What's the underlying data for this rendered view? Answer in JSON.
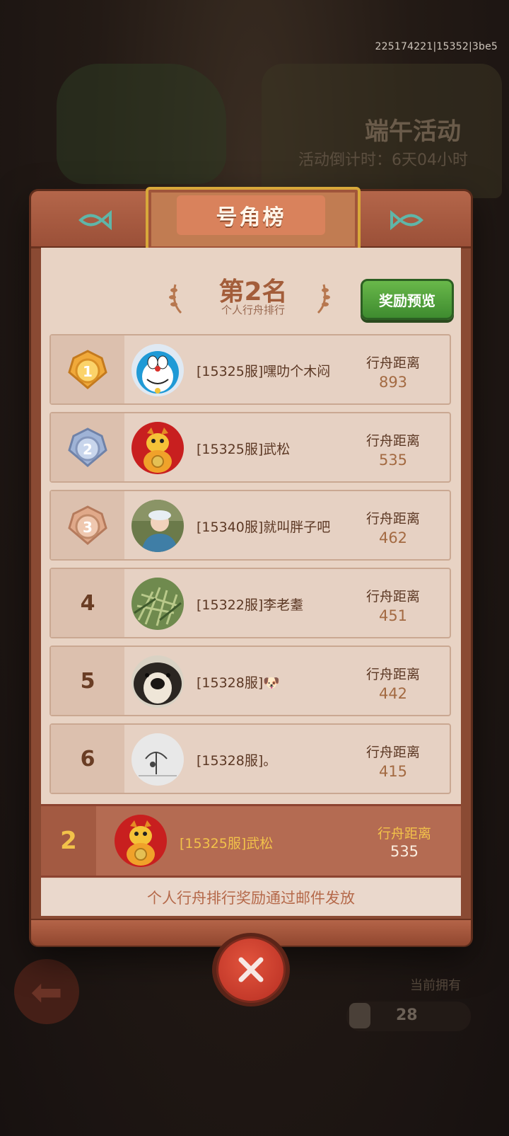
{
  "session_id": "225174221|15352|3be5",
  "background": {
    "event_title": "端午活动",
    "countdown": "活动倒计时：6天04小时",
    "owned_label": "当前拥有",
    "owned_count": "28"
  },
  "panel": {
    "title": "号角榜",
    "my_rank_title": "第2名",
    "my_rank_subtitle": "个人行舟排行",
    "reward_button": "奖励预览",
    "mail_note": "个人行舟排行奖励通过邮件发放"
  },
  "rankings": [
    {
      "rank": "1",
      "name": "[15325服]嘿叻个木闷",
      "dist_label": "行舟距离",
      "distance": "893",
      "avatar": "doraemon-avatar",
      "medal": "gold"
    },
    {
      "rank": "2",
      "name": "[15325服]武松",
      "dist_label": "行舟距离",
      "distance": "535",
      "avatar": "dragon-avatar",
      "medal": "silver"
    },
    {
      "rank": "3",
      "name": "[15340服]就叫胖子吧",
      "dist_label": "行舟距离",
      "distance": "462",
      "avatar": "child-photo-avatar",
      "medal": "bronze"
    },
    {
      "rank": "4",
      "name": "[15322服]李老耋",
      "dist_label": "行舟距离",
      "distance": "451",
      "avatar": "plant-avatar",
      "medal": ""
    },
    {
      "rank": "5",
      "name": "[15328服]🐶",
      "dist_label": "行舟距离",
      "distance": "442",
      "avatar": "dog-avatar",
      "medal": ""
    },
    {
      "rank": "6",
      "name": "[15328服]。",
      "dist_label": "行舟距离",
      "distance": "415",
      "avatar": "sketch-avatar",
      "medal": ""
    }
  ],
  "my_entry": {
    "rank": "2",
    "name": "[15325服]武松",
    "dist_label": "行舟距离",
    "distance": "535"
  }
}
